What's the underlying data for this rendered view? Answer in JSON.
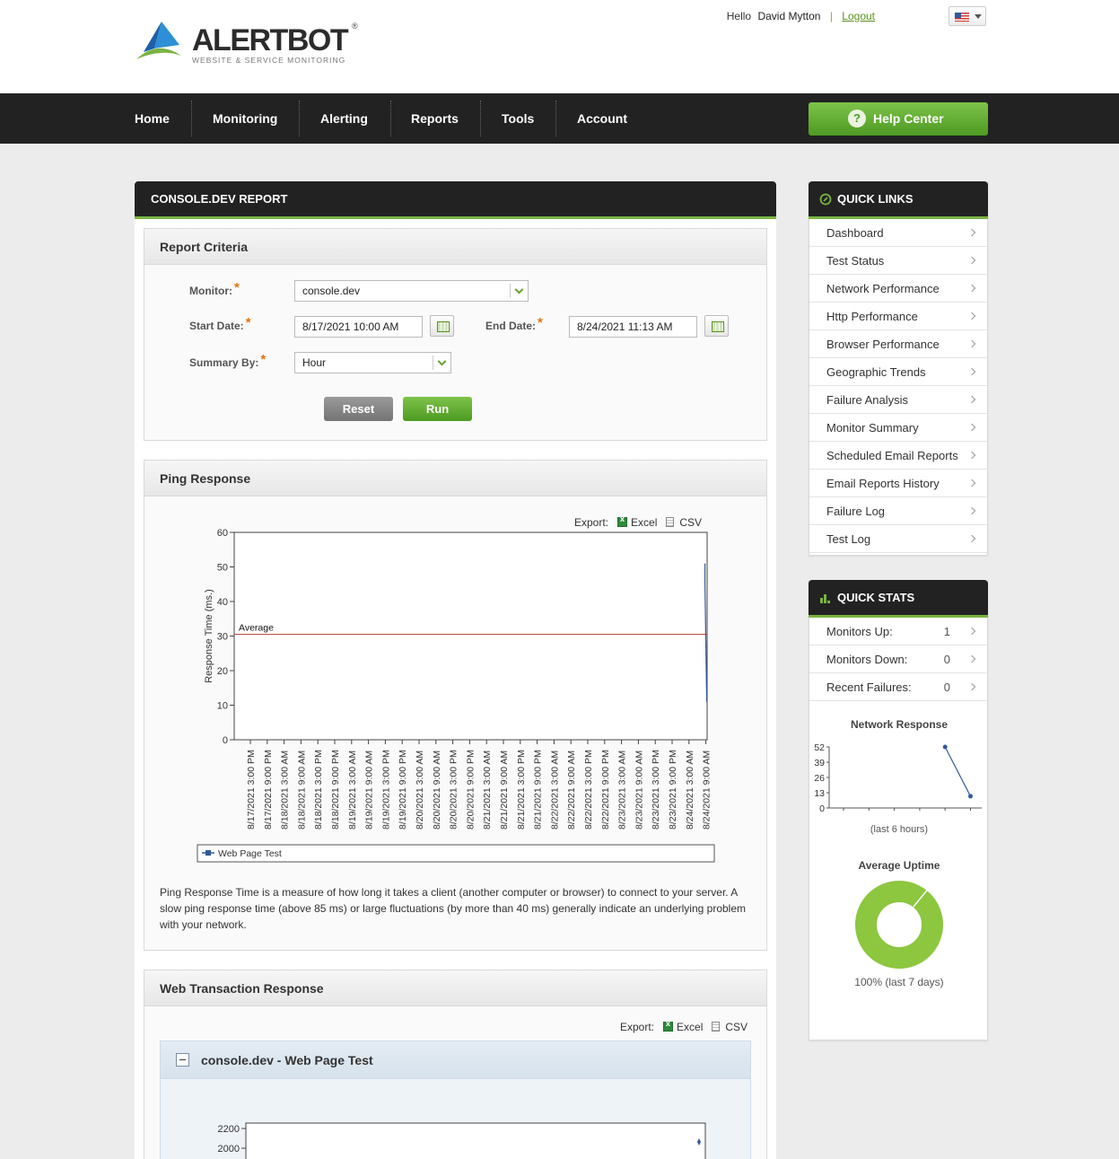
{
  "brand": {
    "name": "ALERTBOT",
    "tagline": "WEBSITE & SERVICE MONITORING",
    "reg": "®"
  },
  "user": {
    "greeting": "Hello",
    "name": "David Mytton",
    "separator": "|",
    "logout": "Logout"
  },
  "nav": {
    "items": [
      "Home",
      "Monitoring",
      "Alerting",
      "Reports",
      "Tools",
      "Account"
    ],
    "help": "Help Center",
    "help_icon": "question-icon"
  },
  "report": {
    "title": "CONSOLE.DEV REPORT",
    "criteria": {
      "title": "Report Criteria",
      "monitor_label": "Monitor:",
      "monitor_value": "console.dev",
      "start_label": "Start Date:",
      "start_value": "8/17/2021 10:00 AM",
      "end_label": "End Date:",
      "end_value": "8/24/2021 11:13 AM",
      "summary_label": "Summary By:",
      "summary_value": "Hour",
      "required_mark": "*",
      "reset": "Reset",
      "run": "Run"
    },
    "ping": {
      "title": "Ping Response",
      "export_label": "Export:",
      "excel": "Excel",
      "csv": "CSV",
      "legend": "Web Page Test",
      "average_label": "Average",
      "description": "Ping Response Time is a measure of how long it takes a client (another computer or browser) to connect to your server. A slow ping response time (above 85 ms) or large fluctuations (by more than 40 ms) generally indicate an underlying problem with your network."
    },
    "web": {
      "title": "Web Transaction Response",
      "export_label": "Export:",
      "excel": "Excel",
      "csv": "CSV",
      "monitor_title": "console.dev - Web Page Test"
    }
  },
  "chart_data": [
    {
      "type": "line",
      "title": "",
      "ylabel": "Response Time (ms.)",
      "xlabel": "",
      "ylim": [
        0,
        60
      ],
      "yticks": [
        0,
        10,
        20,
        30,
        40,
        50,
        60
      ],
      "categories": [
        "8/17/2021 3:00 PM",
        "8/17/2021 9:00 PM",
        "8/18/2021 3:00 AM",
        "8/18/2021 9:00 AM",
        "8/18/2021 3:00 PM",
        "8/18/2021 9:00 PM",
        "8/19/2021 3:00 AM",
        "8/19/2021 9:00 AM",
        "8/19/2021 3:00 PM",
        "8/19/2021 9:00 PM",
        "8/20/2021 3:00 AM",
        "8/20/2021 9:00 AM",
        "8/20/2021 3:00 PM",
        "8/20/2021 9:00 PM",
        "8/21/2021 3:00 AM",
        "8/21/2021 9:00 AM",
        "8/21/2021 3:00 PM",
        "8/21/2021 9:00 PM",
        "8/22/2021 3:00 AM",
        "8/22/2021 9:00 AM",
        "8/22/2021 3:00 PM",
        "8/22/2021 9:00 PM",
        "8/23/2021 3:00 AM",
        "8/23/2021 9:00 AM",
        "8/23/2021 3:00 PM",
        "8/23/2021 9:00 PM",
        "8/24/2021 3:00 AM",
        "8/24/2021 9:00 AM"
      ],
      "series": [
        {
          "name": "Web Page Test",
          "color": "#33599a",
          "x": [
            "8/24/2021 9:00 AM",
            "8/24/2021 9:00 AM",
            "8/24/2021 10:00 AM"
          ],
          "values": [
            51,
            45,
            11
          ]
        }
      ],
      "average": 30.5,
      "average_color": "#c0392b",
      "legend": "bottom",
      "grid": false
    },
    {
      "type": "line",
      "title": "Network Response",
      "yticks": [
        0,
        13,
        26,
        39,
        52
      ],
      "ylim": [
        0,
        52
      ],
      "note": "(last 6 hours)",
      "series": [
        {
          "name": "",
          "color": "#33599a",
          "x": [
            4,
            5
          ],
          "values": [
            52,
            10
          ]
        }
      ],
      "x_count": 6
    },
    {
      "type": "pie",
      "title": "Average Uptime",
      "slices": [
        {
          "label": "Up",
          "value": 100,
          "color": "#8dc63f"
        }
      ],
      "note": "100% (last 7 days)"
    },
    {
      "type": "line",
      "title": "",
      "yticks": [
        2000,
        2200
      ],
      "series": []
    }
  ],
  "quick_links": {
    "title": "QUICK LINKS",
    "items": [
      "Dashboard",
      "Test Status",
      "Network Performance",
      "Http Performance",
      "Browser Performance",
      "Geographic Trends",
      "Failure Analysis",
      "Monitor Summary",
      "Scheduled Email Reports",
      "Email Reports History",
      "Failure Log",
      "Test Log"
    ]
  },
  "quick_stats": {
    "title": "QUICK STATS",
    "rows": [
      {
        "label": "Monitors Up:",
        "value": "1"
      },
      {
        "label": "Monitors Down:",
        "value": "0"
      },
      {
        "label": "Recent Failures:",
        "value": "0"
      }
    ],
    "network_title": "Network Response",
    "network_note": "(last 6 hours)",
    "uptime_title": "Average Uptime",
    "uptime_note": "100% (last 7 days)"
  },
  "colors": {
    "accent": "#7ab342",
    "nav_bg": "#222222",
    "required": "#e8730c"
  }
}
